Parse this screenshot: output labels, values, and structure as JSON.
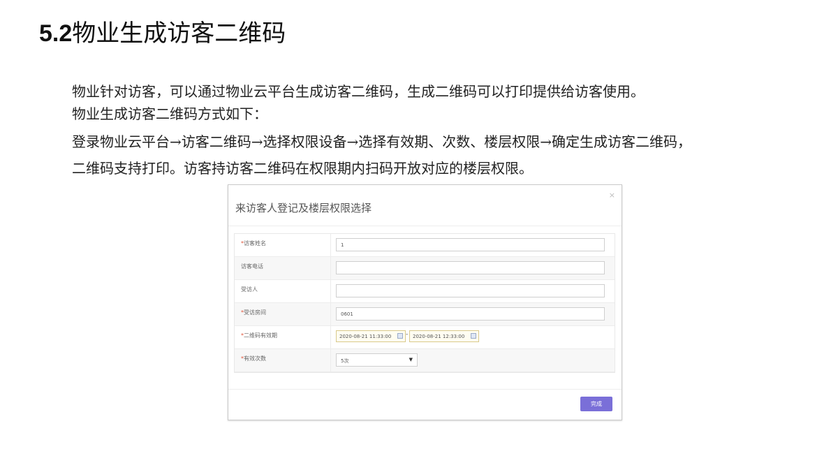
{
  "heading": {
    "number": "5.2",
    "title": "物业生成访客二维码"
  },
  "paragraphs": [
    "物业针对访客，可以通过物业云平台生成访客二维码，生成二维码可以打印提供给访客使用。",
    "物业生成访客二维码方式如下：",
    "登录物业云平台→访客二维码→选择权限设备→选择有效期、次数、楼层权限→确定生成访客二维码，",
    "二维码支持打印。访客持访客二维码在权限期内扫码开放对应的楼层权限。"
  ],
  "dialog": {
    "title": "来访客人登记及楼层权限选择",
    "close": "×",
    "fields": {
      "visitor_name": {
        "required": true,
        "label": "访客姓名",
        "value": "1"
      },
      "visitor_phone": {
        "required": false,
        "label": "访客电话",
        "value": ""
      },
      "host": {
        "required": false,
        "label": "受访人",
        "value": ""
      },
      "room": {
        "required": true,
        "label": "受访房间",
        "value": "0601"
      },
      "validity": {
        "required": true,
        "label": "二维码有效期",
        "start": "2020-08-21 11:33:00",
        "separator": "-",
        "end": "2020-08-21 12:33:00"
      },
      "count": {
        "required": true,
        "label": "有效次数",
        "value": "5次",
        "arrow": "▼"
      }
    },
    "required_mark": "*",
    "done_label": "完成"
  }
}
